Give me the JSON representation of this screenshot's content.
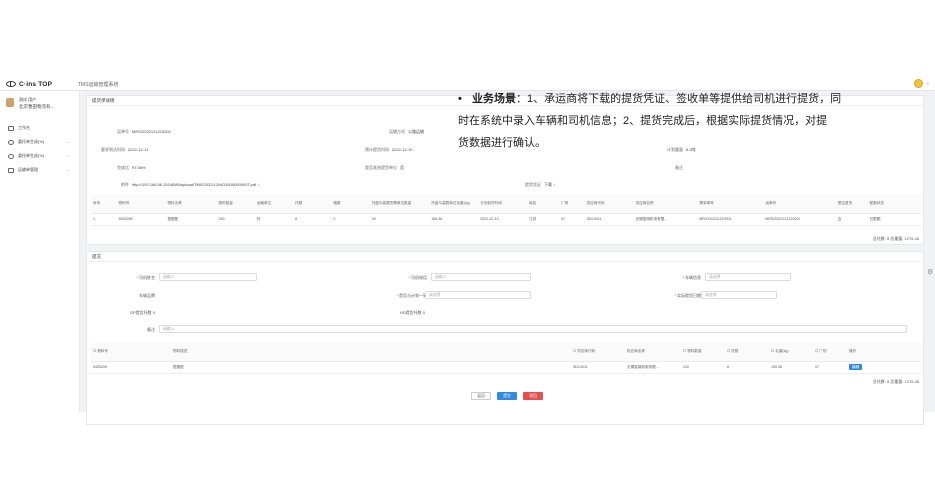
{
  "app": {
    "logo_text": "C·ins TOP",
    "system_title": "TMS运输管理系统"
  },
  "sidebar": {
    "user_name": "测试  用户",
    "user_org": "北京曹田物流有...",
    "items": [
      {
        "label": "工作台",
        "has_chevron": false
      },
      {
        "label": "委托单生成(%)",
        "has_chevron": true
      },
      {
        "label": "委托单生成(%)",
        "has_chevron": true
      },
      {
        "label": "运输单管理",
        "has_chevron": true
      }
    ]
  },
  "panel1": {
    "title": "提货单详情",
    "fields": {
      "order_no_label": "运单号",
      "order_no": "MRS/2022121210001",
      "transport_mode_label": "运输方式",
      "transport_mode": "公路运输",
      "req_time_label": "要求到达时间",
      "req_time": "2022-12-11",
      "plan_time_label": "预计提货时间",
      "plan_time": "2022-12-10",
      "weight_label": "计划重量",
      "weight": "6.2吨",
      "rate_label": "完成比",
      "rate": "97.06%",
      "urgent_label": "是否紧急提货单位",
      "urgent": "否",
      "remark_label": "备注",
      "remark": "",
      "attach_label": "附件",
      "attach": "http://192.168.66.153:8080/upload/TMS/2022/12/NO1600000000T.pdf ↓",
      "receipt_label": "提货凭证",
      "receipt": "下载 ↓"
    },
    "table": {
      "headers": [
        "序号",
        "物料号",
        "物料名称",
        "物料数量",
        "运输单位",
        "托数",
        "箱数",
        "托盘与装载所需单位数量",
        "托盘与装载单位毛重(kg)",
        "计划到货时间",
        "库区",
        "厂别",
        "供应商代码",
        "供应商名称",
        "需求单号",
        "运单号",
        "是否退货",
        "配额状态"
      ],
      "rows": [
        [
          "1",
          "5453259",
          "垫圈垫",
          "240",
          "件",
          "8",
          "0",
          "30",
          "159.36",
          "2022-12-10",
          "江苏",
          "07",
          "SDL0011",
          "无锡富瑞机电有限...",
          "MRZX20221210001",
          "MRS/2022121210001",
          "否",
          "已配额"
        ]
      ],
      "summary": "总托数: 8    总重量: 1276.48"
    }
  },
  "panel2": {
    "title": "提交",
    "form": {
      "plate_label": "司机姓名",
      "plate_placeholder": "请输入",
      "driver_label": "司机电话",
      "driver_placeholder": "请输入",
      "car_label": "车辆信息",
      "car_placeholder": "请选择",
      "vehicle_label": "车辆品牌",
      "vehicle_value": "",
      "confirm_label": "是否与计划一致",
      "confirm_placeholder": "请选择",
      "actual_time_label": "实际提货日期",
      "actual_time_placeholder": "请选择",
      "gp_label": "GP提货托数",
      "gp_value": "0",
      "hd_label": "HD提货托数",
      "hd_value": "0",
      "remark_label": "备注",
      "remark_placeholder": "请输入"
    },
    "table": {
      "headers": [
        "物料号",
        "物料描述",
        "供应商代码",
        "供应商名称",
        "物料数量",
        "托数",
        "毛重(kg)",
        "厂别",
        "操作"
      ],
      "rows": [
        [
          "5453259",
          "垫圈垫",
          "SDL0011",
          "无锡富瑞机电有限...",
          "240",
          "8",
          "159.36",
          "07",
          "编辑"
        ]
      ],
      "summary": "总托数: 8    总重量: 1276.48"
    },
    "buttons": {
      "back": "返回",
      "submit": "提交",
      "reject": "驳回"
    }
  },
  "overlay": {
    "bullet": "•",
    "heading": "业务场景",
    "line1": "：1、承运商将下载的提货凭证、签收单等提供给司机进行提货，同",
    "line2": "时在系统中录入车辆和司机信息；2、提货完成后，根据实际提货情况，对提",
    "line3": "货数据进行确认。"
  }
}
